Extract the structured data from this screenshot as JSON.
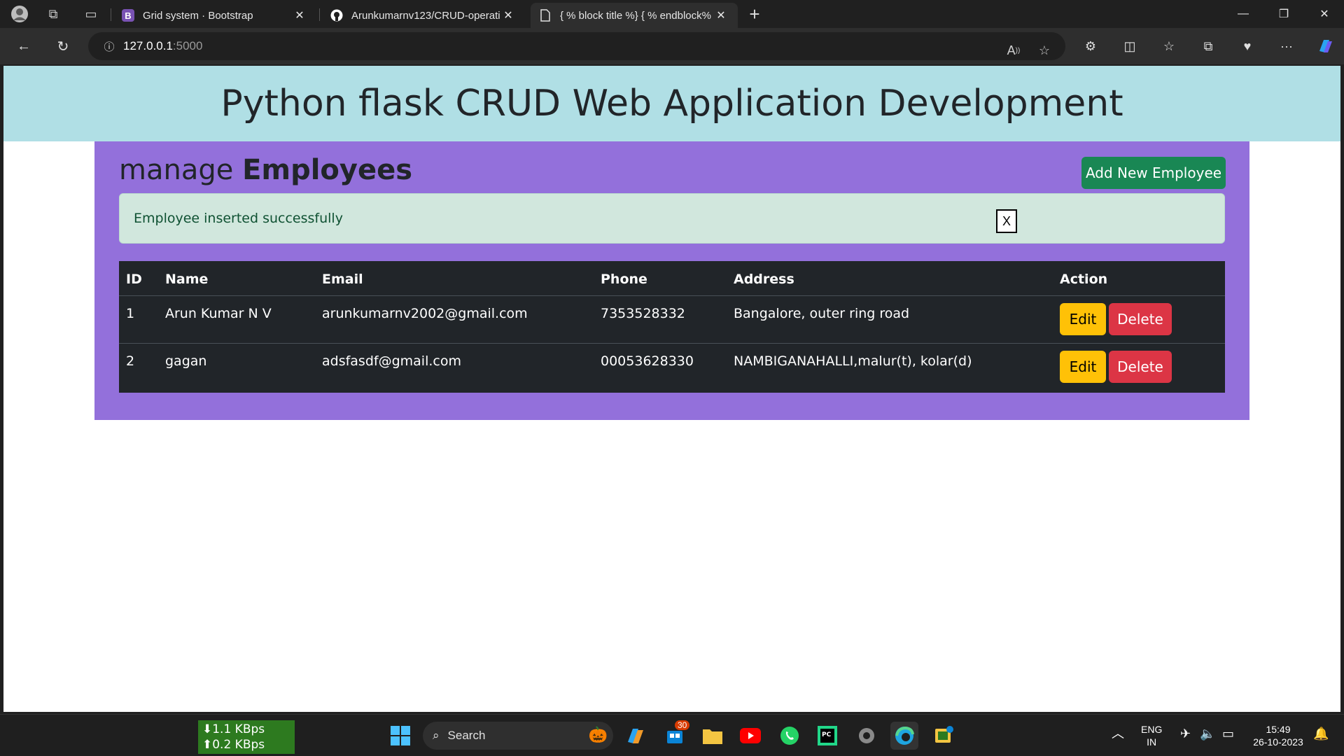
{
  "browser": {
    "tabs": [
      {
        "favicon": "B",
        "title": "Grid system · Bootstrap"
      },
      {
        "favicon": "github-icon",
        "title": "Arunkumarnv123/CRUD-operati"
      },
      {
        "favicon": "document-icon",
        "title": "{ % block title %} { % endblock%"
      }
    ],
    "url_host": "127.0.0.1",
    "url_port": ":5000"
  },
  "page": {
    "heading": "Python flask CRUD Web Application Development",
    "manage_prefix": "manage ",
    "manage_bold": "Employees",
    "add_button": "Add New Employee",
    "alert_message": "Employee inserted successfully",
    "alert_close": "X",
    "table": {
      "headers": [
        "ID",
        "Name",
        "Email",
        "Phone",
        "Address",
        "Action"
      ],
      "rows": [
        {
          "id": "1",
          "name": "Arun Kumar N V",
          "email": "arunkumarnv2002@gmail.com",
          "phone": "7353528332",
          "address": "Bangalore, outer ring road"
        },
        {
          "id": "2",
          "name": "gagan",
          "email": "adsfasdf@gmail.com",
          "phone": "00053628330",
          "address": "NAMBIGANAHALLI,malur(t), kolar(d)"
        }
      ],
      "edit_label": "Edit",
      "delete_label": "Delete"
    },
    "colors": {
      "header_bg": "#b0dfe5",
      "panel_bg": "#9370db",
      "add_btn": "#198754",
      "edit_btn": "#ffc107",
      "delete_btn": "#dc3545"
    }
  },
  "taskbar": {
    "net_down": "⬇1.1 KBps",
    "net_up": "⬆0.2 KBps",
    "search_label": "Search",
    "store_badge": "30",
    "lang_top": "ENG",
    "lang_bottom": "IN",
    "time": "15:49",
    "date": "26-10-2023"
  }
}
